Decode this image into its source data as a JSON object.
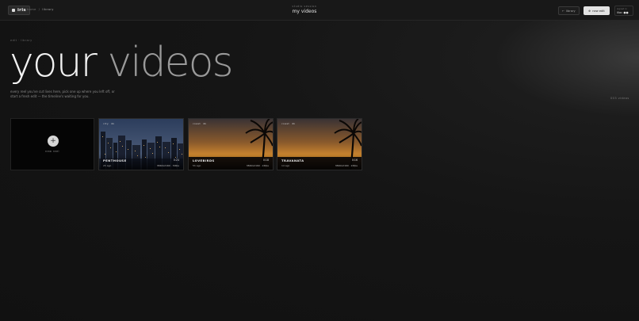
{
  "app": {
    "name": "iris"
  },
  "breadcrumb": [
    "home",
    "library"
  ],
  "header": {
    "kicker": "studio session",
    "title": "my videos"
  },
  "actions": {
    "secondary": "library",
    "primary": "new edit"
  },
  "user": {
    "kicker": "signed in",
    "name": "lilac ●●"
  },
  "page": {
    "section": "edit · library",
    "title_a": "your ",
    "title_b": "videos",
    "subtitle": "every reel you've cut lives here, pick one up where you left off, or start a fresh edit — the timeline's waiting for you.",
    "count": "003 videos"
  },
  "new_card": {
    "label": "new reel"
  },
  "videos": [
    {
      "tags": [
        "city",
        "4k"
      ],
      "title": "PENTHOUSE",
      "duration": "0:24",
      "meta": "2h ago",
      "resolution": "3840x2160 · 30fps"
    },
    {
      "tags": [
        "coast",
        "4k"
      ],
      "title": "LOVEBIRDS",
      "duration": "0:18",
      "meta": "5h ago",
      "resolution": "3840x2160 · 24fps"
    },
    {
      "tags": [
        "coast",
        "4k"
      ],
      "title": "TRAVANATA",
      "duration": "0:16",
      "meta": "1d ago",
      "resolution": "3840x2160 · 24fps"
    }
  ],
  "colors": {
    "accent": "#e3e3e3",
    "background": "#151515"
  }
}
